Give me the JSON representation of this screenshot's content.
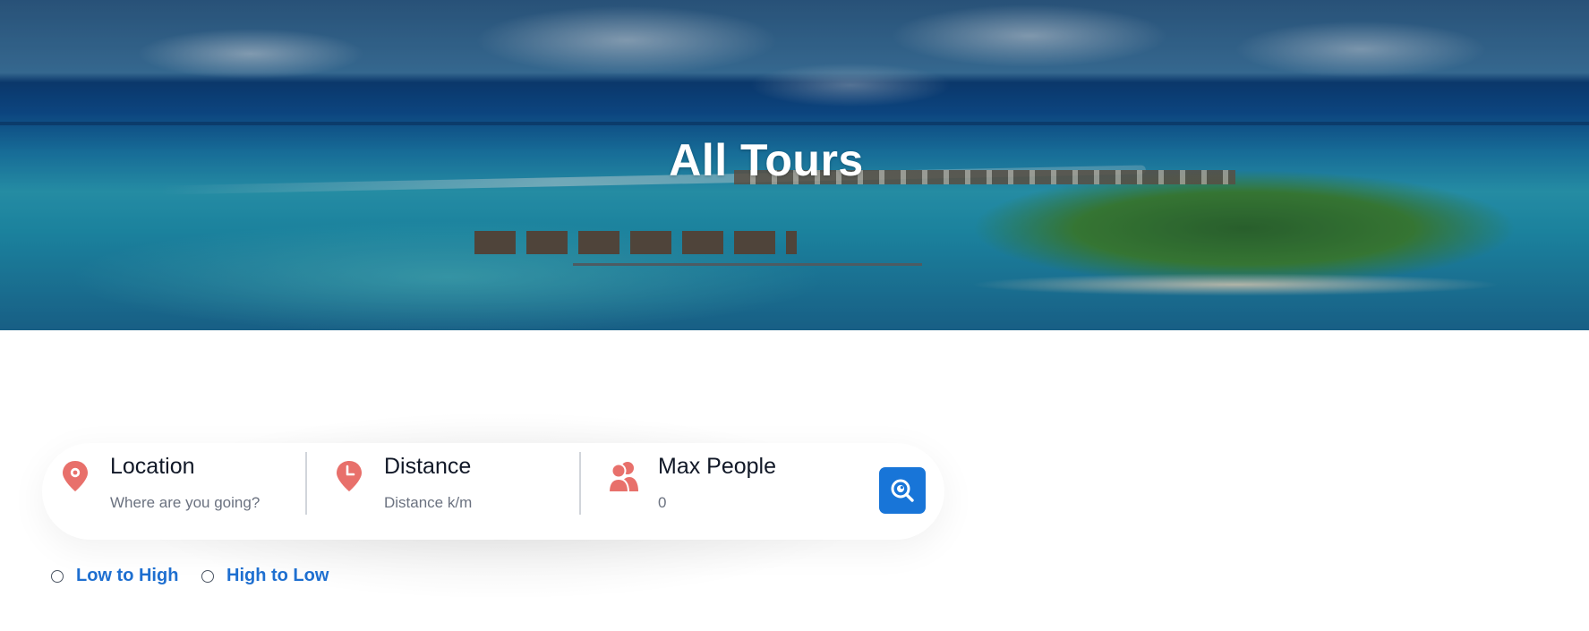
{
  "hero": {
    "title": "All Tours"
  },
  "search": {
    "location": {
      "label": "Location",
      "placeholder": "Where are you going?",
      "icon": "map-pin-icon"
    },
    "distance": {
      "label": "Distance",
      "placeholder": "Distance k/m",
      "icon": "clock-pin-icon"
    },
    "max_people": {
      "label": "Max People",
      "placeholder": "0",
      "icon": "group-icon"
    },
    "button_icon": "search-icon"
  },
  "sort": {
    "options": [
      {
        "label": "Low to High"
      },
      {
        "label": "High to Low"
      }
    ]
  },
  "colors": {
    "accent": "#1875d8",
    "icon_coral": "#e8706b",
    "sort_text": "#1e6fd0"
  }
}
